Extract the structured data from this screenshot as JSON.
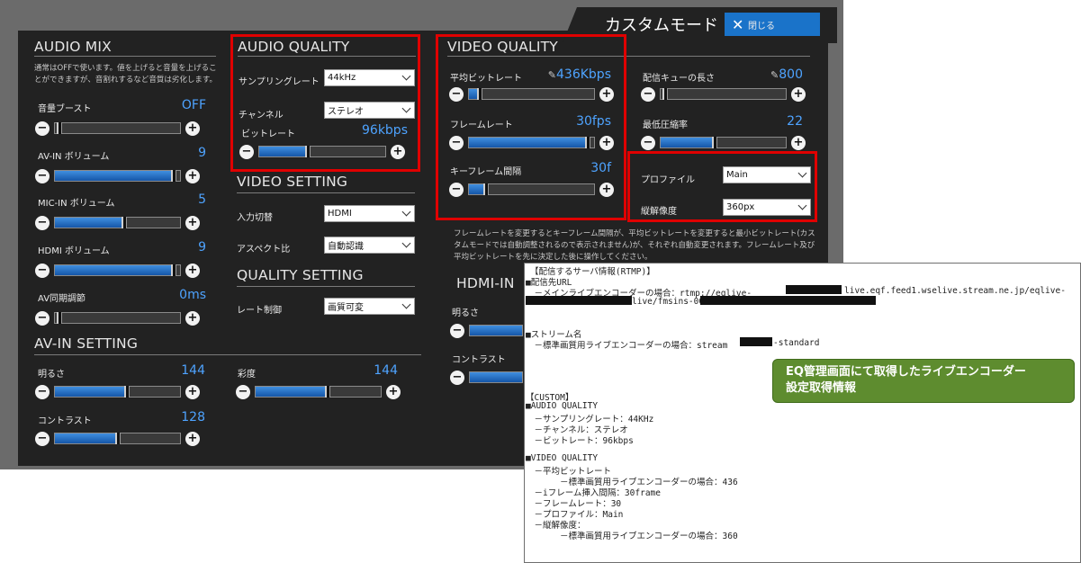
{
  "window": {
    "title": "カスタムモード",
    "close_label": "閉じる"
  },
  "audio_mix": {
    "heading": "AUDIO MIX",
    "note": "通常はOFFで使います。値を上げると音量を上げることができますが、音割れするなど音質は劣化します。",
    "rows": [
      {
        "label": "音量ブースト",
        "value": "OFF",
        "level": 0.0
      },
      {
        "label": "AV-IN ボリューム",
        "value": "9",
        "level": 0.97
      },
      {
        "label": "MIC-IN ボリューム",
        "value": "5",
        "level": 0.56
      },
      {
        "label": "HDMI ボリューム",
        "value": "9",
        "level": 0.97
      },
      {
        "label": "AV同期調節",
        "value": "0ms",
        "level": 0.0
      }
    ]
  },
  "audio_quality": {
    "heading": "AUDIO QUALITY",
    "sample_rate_label": "サンプリングレート",
    "sample_rate_value": "44kHz",
    "channel_label": "チャンネル",
    "channel_value": "ステレオ",
    "bitrate_label": "ビットレート",
    "bitrate_value": "96kbps",
    "bitrate_level": 0.38
  },
  "video_setting": {
    "heading": "VIDEO SETTING",
    "input_label": "入力切替",
    "input_value": "HDMI",
    "aspect_label": "アスペクト比",
    "aspect_value": "自動認識"
  },
  "quality_setting": {
    "heading": "QUALITY SETTING",
    "rate_label": "レート制御",
    "rate_value": "画質可変"
  },
  "video_quality": {
    "heading": "VIDEO QUALITY",
    "avg_bitrate_label": "平均ビットレート",
    "avg_bitrate_value": "436Kbps",
    "avg_bitrate_level": 0.07,
    "framerate_label": "フレームレート",
    "framerate_value": "30fps",
    "framerate_level": 0.97,
    "keyframe_label": "キーフレーム間隔",
    "keyframe_value": "30f",
    "keyframe_level": 0.12,
    "queue_label": "配信キューの長さ",
    "queue_value": "800",
    "queue_level": 0.0,
    "min_comp_label": "最低圧縮率",
    "min_comp_value": "22",
    "min_comp_level": 0.43,
    "profile_label": "プロファイル",
    "profile_value": "Main",
    "resolution_label": "縦解像度",
    "resolution_value": "360px",
    "note": "フレームレートを変更するとキーフレーム間隔が、平均ビットレートを変更すると最小ビットレート(カスタムモードでは自動調整されるので表示されません)が、それぞれ自動変更されます。フレームレート及び平均ビットレートを先に決定した後に操作してください。"
  },
  "hdmi_in": {
    "heading": "HDMI-IN",
    "brightness_label": "明るさ",
    "contrast_label": "コントラスト"
  },
  "av_in_setting": {
    "heading": "AV-IN SETTING",
    "brightness_label": "明るさ",
    "brightness_value": "144",
    "brightness_level": 0.58,
    "contrast_label": "コントラスト",
    "contrast_value": "128",
    "contrast_level": 0.5,
    "saturation_label": "彩度",
    "saturation_value": "144",
    "saturation_level": 0.58
  },
  "doc": {
    "lines": [
      "【配信するサーバ情報(RTMP)】",
      "■配信先URL",
      "　－メインライブエンコーダーの場合：rtmp://eqlive-",
      "live.eqf.feed1.wselive.stream.ne.jp/eqlive-",
      "live/fmsins-00001?",
      "■ストリーム名",
      "　－標準画質用ライブエンコーダーの場合：stream",
      "-standard",
      "【CUSTOM】",
      "■AUDIO QUALITY",
      "　－サンプリングレート：44KHz",
      "　－チャンネル：ステレオ",
      "　－ビットレート：96kbps",
      "■VIDEO QUALITY",
      "　－平均ビットレート",
      "　　　　－標準画質用ライブエンコーダーの場合：436",
      "　－iフレーム挿入間隔：30frame",
      "　－フレームレート：30",
      "　－プロファイル：Main",
      "　－縦解像度：",
      "　　　　－標準画質用ライブエンコーダーの場合：360"
    ],
    "callout_line1": "EQ管理画面にて取得したライブエンコーダー",
    "callout_line2": "設定取得情報"
  },
  "colors": {
    "accent": "#4ea3ff",
    "highlight": "#e00000",
    "callout": "#5e8c2f",
    "close_button": "#1a73c9"
  }
}
